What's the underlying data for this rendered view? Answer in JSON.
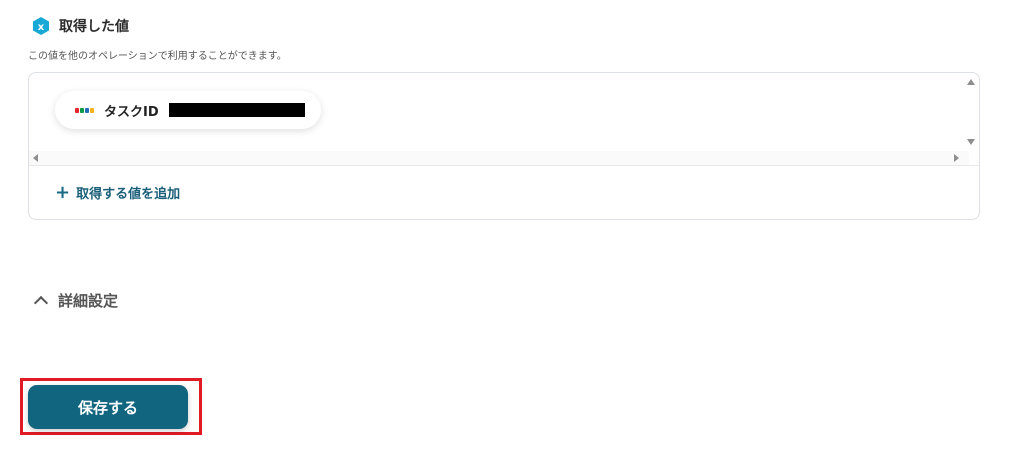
{
  "section": {
    "title": "取得した値",
    "description": "この値を他のオペレーションで利用することができます。",
    "icon": "yoom-hexagon-icon",
    "icon_color": "#19a9d6"
  },
  "values": [
    {
      "label": "タスクID",
      "app_icon": "zoho-logo-icon",
      "value_redacted": true
    }
  ],
  "add_value": {
    "label": "取得する値を追加"
  },
  "advanced": {
    "label": "詳細設定",
    "expanded": true
  },
  "save": {
    "label": "保存する",
    "color": "#12657f",
    "highlight_color": "#e01b24"
  }
}
